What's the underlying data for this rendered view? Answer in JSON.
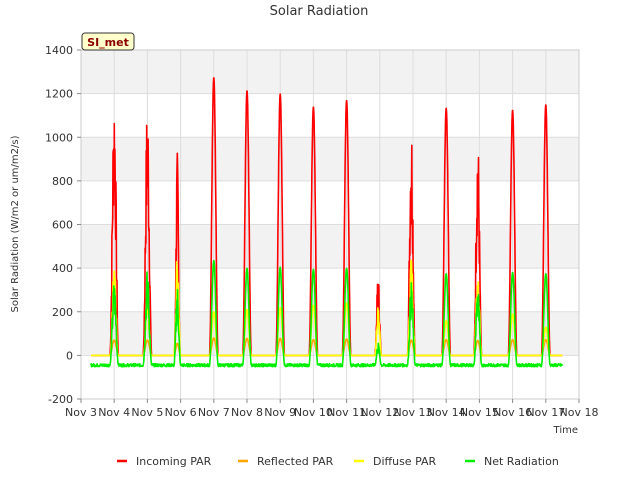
{
  "chart_data": {
    "type": "line",
    "title": "Solar Radiation",
    "xlabel": "Time",
    "ylabel": "Solar Radiation (W/m2 or um/m2/s)",
    "ylim": [
      -200,
      1400
    ],
    "xlim": [
      3,
      18
    ],
    "yticks": [
      -200,
      0,
      200,
      400,
      600,
      800,
      1000,
      1200,
      1400
    ],
    "xticks": [
      {
        "value": 3,
        "label": "Nov 3"
      },
      {
        "value": 4,
        "label": "Nov 4"
      },
      {
        "value": 5,
        "label": "Nov 5"
      },
      {
        "value": 6,
        "label": "Nov 6"
      },
      {
        "value": 7,
        "label": "Nov 7"
      },
      {
        "value": 8,
        "label": "Nov 8"
      },
      {
        "value": 9,
        "label": "Nov 9"
      },
      {
        "value": 10,
        "label": "Nov 10"
      },
      {
        "value": 11,
        "label": "Nov 11"
      },
      {
        "value": 12,
        "label": "Nov 12"
      },
      {
        "value": 13,
        "label": "Nov 13"
      },
      {
        "value": 14,
        "label": "Nov 14"
      },
      {
        "value": 15,
        "label": "Nov 15"
      },
      {
        "value": 16,
        "label": "Nov 16"
      },
      {
        "value": 17,
        "label": "Nov 17"
      },
      {
        "value": 18,
        "label": "Nov 18"
      }
    ],
    "grid": true,
    "legend_placement": "bottom",
    "site_label": "SI_met",
    "series": [
      {
        "name": "Incoming PAR",
        "color": "#ff0000",
        "peaks": [
          {
            "center": 4.0,
            "amp": 1250,
            "width": 0.13,
            "noisy": true
          },
          {
            "center": 5.0,
            "amp": 1180,
            "width": 0.13,
            "noisy": true
          },
          {
            "center": 5.9,
            "amp": 940,
            "width": 0.09,
            "noisy": true
          },
          {
            "center": 7.0,
            "amp": 1275,
            "width": 0.13,
            "noisy": false
          },
          {
            "center": 8.0,
            "amp": 1215,
            "width": 0.13,
            "noisy": false
          },
          {
            "center": 9.0,
            "amp": 1200,
            "width": 0.13,
            "noisy": false
          },
          {
            "center": 10.0,
            "amp": 1140,
            "width": 0.13,
            "noisy": false
          },
          {
            "center": 11.0,
            "amp": 1170,
            "width": 0.13,
            "noisy": false
          },
          {
            "center": 11.95,
            "amp": 375,
            "width": 0.1,
            "noisy": true
          },
          {
            "center": 12.95,
            "amp": 1100,
            "width": 0.12,
            "noisy": true
          },
          {
            "center": 14.0,
            "amp": 1135,
            "width": 0.13,
            "noisy": false
          },
          {
            "center": 14.95,
            "amp": 1030,
            "width": 0.12,
            "noisy": true
          },
          {
            "center": 16.0,
            "amp": 1125,
            "width": 0.13,
            "noisy": false
          },
          {
            "center": 17.0,
            "amp": 1150,
            "width": 0.13,
            "noisy": false
          }
        ],
        "base": 0
      },
      {
        "name": "Reflected PAR",
        "color": "#ffa500",
        "peaks": [
          {
            "center": 4.0,
            "amp": 70,
            "width": 0.13,
            "noisy": false
          },
          {
            "center": 5.0,
            "amp": 70,
            "width": 0.13,
            "noisy": false
          },
          {
            "center": 5.9,
            "amp": 55,
            "width": 0.1,
            "noisy": false
          },
          {
            "center": 7.0,
            "amp": 80,
            "width": 0.13,
            "noisy": false
          },
          {
            "center": 8.0,
            "amp": 78,
            "width": 0.13,
            "noisy": false
          },
          {
            "center": 9.0,
            "amp": 78,
            "width": 0.13,
            "noisy": false
          },
          {
            "center": 10.0,
            "amp": 72,
            "width": 0.13,
            "noisy": false
          },
          {
            "center": 11.0,
            "amp": 75,
            "width": 0.13,
            "noisy": false
          },
          {
            "center": 11.95,
            "amp": 20,
            "width": 0.1,
            "noisy": false
          },
          {
            "center": 12.95,
            "amp": 70,
            "width": 0.12,
            "noisy": false
          },
          {
            "center": 14.0,
            "amp": 72,
            "width": 0.13,
            "noisy": false
          },
          {
            "center": 14.95,
            "amp": 68,
            "width": 0.12,
            "noisy": false
          },
          {
            "center": 16.0,
            "amp": 72,
            "width": 0.13,
            "noisy": false
          },
          {
            "center": 17.0,
            "amp": 72,
            "width": 0.13,
            "noisy": false
          }
        ],
        "base": 0
      },
      {
        "name": "Diffuse PAR",
        "color": "#ffff00",
        "peaks": [
          {
            "center": 4.0,
            "amp": 430,
            "width": 0.12,
            "noisy": true
          },
          {
            "center": 5.0,
            "amp": 300,
            "width": 0.12,
            "noisy": true
          },
          {
            "center": 5.9,
            "amp": 490,
            "width": 0.1,
            "noisy": true
          },
          {
            "center": 7.0,
            "amp": 200,
            "width": 0.13,
            "noisy": false
          },
          {
            "center": 8.0,
            "amp": 210,
            "width": 0.13,
            "noisy": false
          },
          {
            "center": 9.0,
            "amp": 220,
            "width": 0.13,
            "noisy": false
          },
          {
            "center": 10.0,
            "amp": 230,
            "width": 0.13,
            "noisy": false
          },
          {
            "center": 11.0,
            "amp": 240,
            "width": 0.13,
            "noisy": false
          },
          {
            "center": 11.95,
            "amp": 230,
            "width": 0.1,
            "noisy": true
          },
          {
            "center": 12.95,
            "amp": 460,
            "width": 0.12,
            "noisy": true
          },
          {
            "center": 14.0,
            "amp": 160,
            "width": 0.13,
            "noisy": false
          },
          {
            "center": 14.95,
            "amp": 420,
            "width": 0.12,
            "noisy": true
          },
          {
            "center": 16.0,
            "amp": 190,
            "width": 0.13,
            "noisy": false
          },
          {
            "center": 17.0,
            "amp": 130,
            "width": 0.13,
            "noisy": false
          }
        ],
        "base": 0
      },
      {
        "name": "Net Radiation",
        "color": "#00ee00",
        "peaks": [
          {
            "center": 4.0,
            "amp": 350,
            "width": 0.13,
            "noisy": true
          },
          {
            "center": 5.0,
            "amp": 400,
            "width": 0.13,
            "noisy": true
          },
          {
            "center": 5.9,
            "amp": 330,
            "width": 0.1,
            "noisy": true
          },
          {
            "center": 7.0,
            "amp": 435,
            "width": 0.13,
            "noisy": false
          },
          {
            "center": 8.0,
            "amp": 400,
            "width": 0.13,
            "noisy": false
          },
          {
            "center": 9.0,
            "amp": 405,
            "width": 0.13,
            "noisy": false
          },
          {
            "center": 10.0,
            "amp": 395,
            "width": 0.13,
            "noisy": false
          },
          {
            "center": 11.0,
            "amp": 400,
            "width": 0.13,
            "noisy": false
          },
          {
            "center": 11.95,
            "amp": 60,
            "width": 0.1,
            "noisy": true
          },
          {
            "center": 12.95,
            "amp": 340,
            "width": 0.12,
            "noisy": true
          },
          {
            "center": 14.0,
            "amp": 375,
            "width": 0.13,
            "noisy": false
          },
          {
            "center": 14.95,
            "amp": 330,
            "width": 0.12,
            "noisy": true
          },
          {
            "center": 16.0,
            "amp": 380,
            "width": 0.13,
            "noisy": false
          },
          {
            "center": 17.0,
            "amp": 375,
            "width": 0.13,
            "noisy": false
          }
        ],
        "base": -45
      }
    ]
  }
}
